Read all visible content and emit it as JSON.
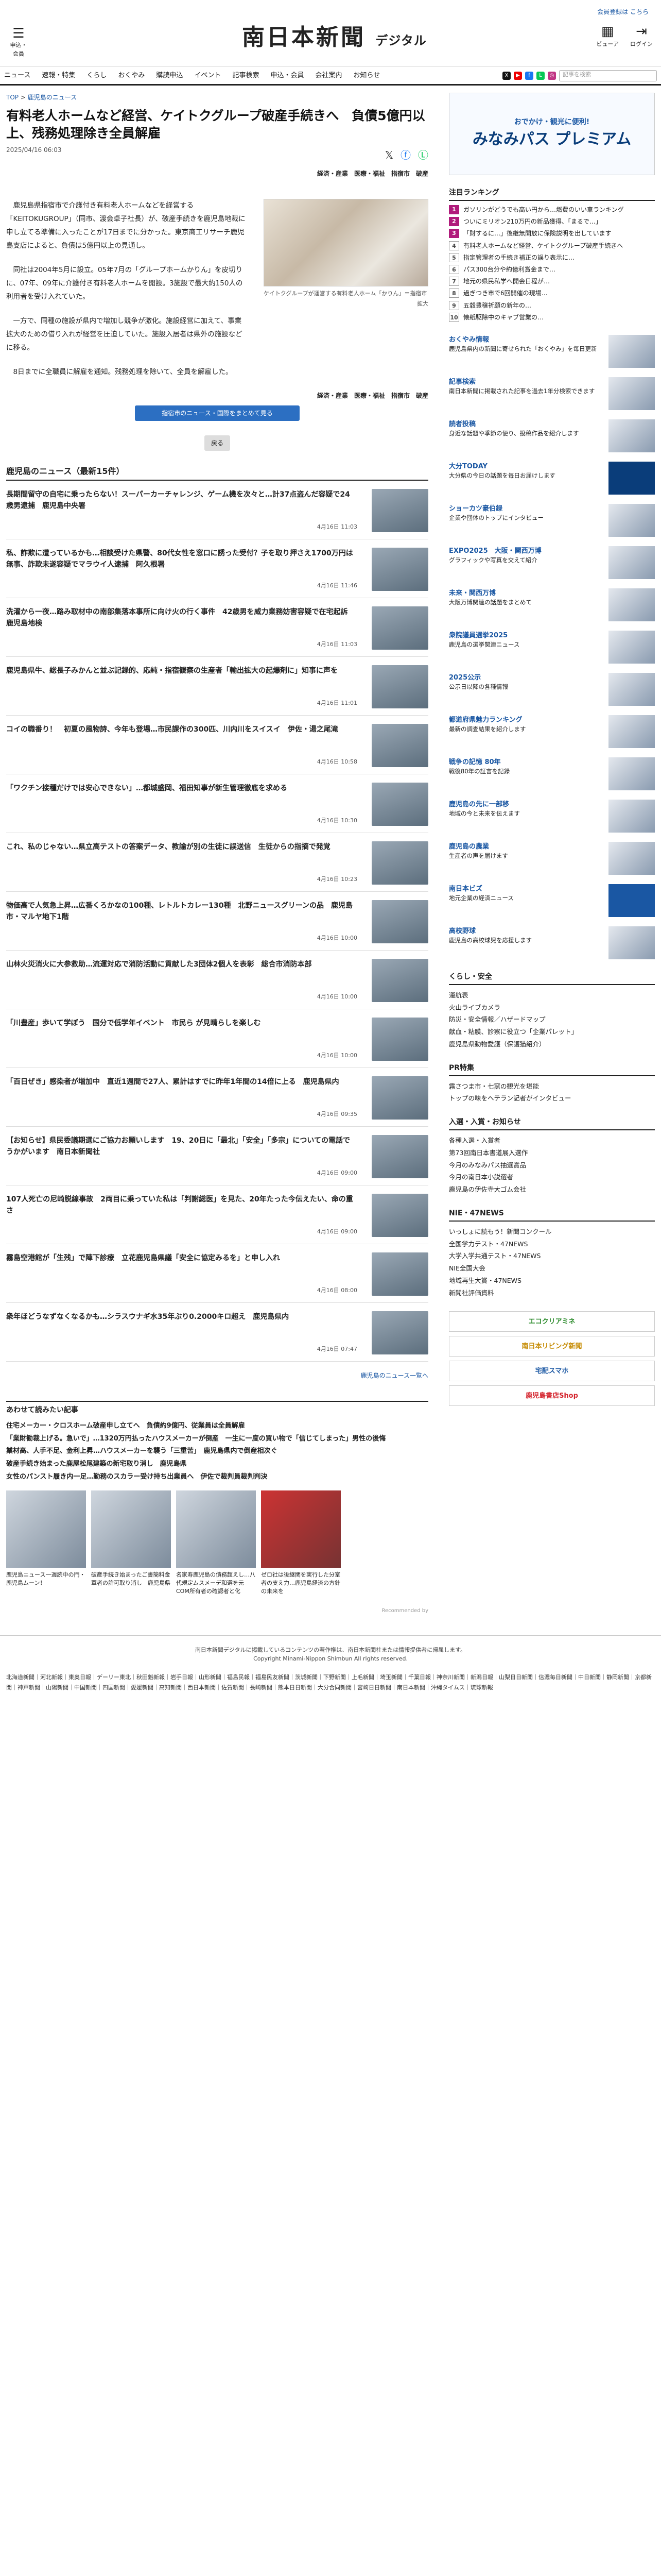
{
  "header": {
    "membership_text": "会員登録は",
    "membership_link": "こちら",
    "logo": "南日本新聞",
    "logo_sub": "デジタル",
    "menu_label": "申込・会員",
    "search_label": "ビューア",
    "login_label": "ログイン"
  },
  "nav": {
    "items": [
      "ニュース",
      "速報・特集",
      "くらし",
      "おくやみ",
      "購読申込",
      "イベント",
      "記事検索",
      "申込・会員",
      "会社案内",
      "お知らせ"
    ],
    "search_placeholder": "記事を検索"
  },
  "breadcrumb": [
    "TOP",
    "鹿児島のニュース"
  ],
  "article": {
    "title": "有料老人ホームなど経営、ケイトクグループ破産手続きへ　負債5億円以上、残務処理除き全員解雇",
    "date": "2025/04/16 06:03",
    "tags": "経済・産業　医療・福祉　指宿市　破産",
    "paragraphs": [
      "鹿児島県指宿市で介護付き有料老人ホームなどを経営する「KEITOKUGROUP」（同市、渡会卓子社長）が、破産手続きを鹿児島地裁に申し立てる準備に入ったことが17日までに分かった。東京商工リサーチ鹿児島支店によると、負債は5億円以上の見通し。",
      "同社は2004年5月に設立。05年7月の「グループホームかりん」を皮切りに、07年、09年に介護付き有料老人ホームを開設。3施設で最大約150人の利用者を受け入れていた。",
      "一方で、同種の施設が県内で増加し競争が激化。施設経営に加えて、事業拡大のための借り入れが経営を圧迫していた。施設入居者は県外の施設などに移る。",
      "8日までに全職員に解雇を通知。残務処理を除いて、全員を解雇した。"
    ],
    "photo_caption": "ケイトクグループが運営する有料老人ホーム「かりん」＝指宿市",
    "photo_more": "拡大",
    "related_button": "指宿市のニュース・国際をまとめて見る",
    "back_button": "戻る"
  },
  "news_section": {
    "title": "鹿児島のニュース（最新15件）",
    "items": [
      {
        "title": "長期間留守の自宅に乗ったらない！スーパーカーチャレンジ、ゲーム機を次々と…計37点盗んだ容疑で24歳男逮捕　鹿児島中央署",
        "date": "4月16日 11:03"
      },
      {
        "title": "私、詐欺に遭っているかも…相談受けた県警、80代女性を窓口に誘った受付？子を取り押さえ1700万円は無事、詐欺未遂容疑でマラウイ人逮捕　阿久根署",
        "date": "4月16日 11:46"
      },
      {
        "title": "洗濯から一夜…路み取材中の南部集落本事所に向け火の行く事件　42歳男を威力業務妨害容疑で在宅起訴　鹿児島地検",
        "date": "4月16日 11:03"
      },
      {
        "title": "鹿児島県牛、総長子みかんと並ぶ記録的、応純・指宿観察の生産者「輸出拡大の起爆剤に」知事に声を",
        "date": "4月16日 11:01"
      },
      {
        "title": "コイの職番り！　初夏の風物詩、今年も登場…市民課作の300匹、川内川をスイスイ　伊佐・湯之尾滝",
        "date": "4月16日 10:58"
      },
      {
        "title": "「ワクチン接種だけでは安心できない」…都城盛岡、福田知事が新生管理徹底を求める",
        "date": "4月16日 10:30"
      },
      {
        "title": "これ、私のじゃない…県立高テストの答案データ、教諭が別の生徒に誤送信　生徒からの指摘で発覚",
        "date": "4月16日 10:23"
      },
      {
        "title": "物価高で人気急上昇…広番くろかなの100種、レトルトカレー130種　北野ニュースグリーンの品　鹿児島市・マルヤ地下1階",
        "date": "4月16日 10:00"
      },
      {
        "title": "山林火災消火に大参救助…流運対応で消防活動に貢献した3団体2個人を表彰　総合市消防本部",
        "date": "4月16日 10:00"
      },
      {
        "title": "「川豊産」歩いて学ぼう　国分で低学年イベント　市民ら が見晴らしを楽しむ",
        "date": "4月16日 10:00"
      },
      {
        "title": "「百日ぜき」感染者が増加中　直近1週間で27人、累計はすでに昨年1年間の14倍に上る　鹿児島県内",
        "date": "4月16日 09:35"
      },
      {
        "title": "【お知らせ】県民委議期選にご協力お願いします　19、20日に「最北」「安全」「多宗」についての電話でうかがいます　南日本新聞社",
        "date": "4月16日 09:00"
      },
      {
        "title": "107人死亡の尼崎脱線事故　2両目に乗っていた私は「判謝総医」を見た、20年たった今伝えたい、命の重さ",
        "date": "4月16日 09:00"
      },
      {
        "title": "霧島空港館が「生残」で陣下診療　立花鹿児島県議「安全に協定みるを」と申し入れ",
        "date": "4月16日 08:00"
      },
      {
        "title": "衆年ほどうなずなくなるかも…シラスウナギ水35年ぶり0.2000キロ超え　鹿児島県内",
        "date": "4月16日 07:47"
      }
    ],
    "more_link": "鹿児島のニュース一覧へ"
  },
  "recommend": {
    "title": "あわせて読みたい記事",
    "items": [
      "住宅メーカー・クロスホーム破産申し立てへ　負債約9億円、従業員は全員解雇",
      "「業財勧裁上げる。急いで」…1320万円払ったハウスメーカーが倒産　一生に一度の買い物で「信じてしまった」男性の後悔",
      "業材高、人手不足、金利上昇…ハウスメーカーを襲う「三重苦」　鹿児島県内で倒産相次ぐ",
      "破産手続き始まった鹿屋松尾建築の新宅取り消し　鹿児島県",
      "女性のパンスト履き内一足…勤務のスカラー受け持ち出業員へ　伊佐で裁判員裁判判決"
    ],
    "cards": [
      "鹿児島ニュース一週読中の門・鹿児島ムーン！",
      "破産手続き始まったご書簡料金軍者の許可取り消し　鹿児島県",
      "名家寿鹿児島の債務超えし…八代規定ムスメーデ和選を元COM所有者の確認者と化",
      "ゼロ社は後継関を実行した分室者の支え力…鹿児島経済の方針の未来を"
    ],
    "ad_label": "Recommended by"
  },
  "sidebar": {
    "ad_line1": "おでかけ・観光に便利!",
    "ad_line2": "みなみパス プレミアム",
    "ranking_title": "注目ランキング",
    "ranking": [
      "ガソリンがどうでも高い円から…燃費のいい車ランキング",
      "ついにミリオン210万円の新品獲得、「まるで…」",
      "「財するに…」後継無開放に保険説明を出しています",
      "有料老人ホームなど経営、ケイトクグループ破産手続きへ",
      "指定管理者の手続き補正の誤り表示に…",
      "パス300台分や約億利賞金まで…",
      "地元の県民私学へ開会日程が…",
      "過ぎつき市で6回開催の現場…",
      "五穀豊穣祈願の新年の…",
      "懐紙駆除中のキャブ営業の…"
    ],
    "features": [
      {
        "name": "おくやみ情報",
        "desc": "鹿児島県内の新聞に寄せられた「おくやみ」を毎日更新"
      },
      {
        "name": "記事検索",
        "desc": "南日本新聞に掲載された記事を過去1年分検索できます"
      },
      {
        "name": "読者投稿",
        "desc": "身近な話題や季節の便り、投稿作品を紹介します"
      },
      {
        "name": "大分TODAY",
        "desc": "大分県の今日の話題を毎日お届けします"
      },
      {
        "name": "ショーカツ豪伯録",
        "desc": "企業や団体のトップにインタビュー"
      },
      {
        "name": "EXPO2025　大阪・関西万博",
        "desc": "グラフィックや写真を交えて紹介"
      },
      {
        "name": "未来・関西万博",
        "desc": "大阪万博関連の話題をまとめて"
      },
      {
        "name": "衆院議員選挙2025",
        "desc": "鹿児島の選挙関連ニュース"
      },
      {
        "name": "2025公示",
        "desc": "公示日以降の各種情報"
      },
      {
        "name": "都道府県魅力ランキング",
        "desc": "最新の調査結果を紹介します"
      },
      {
        "name": "戦争の記憶 80年",
        "desc": "戦後80年の証言を記録"
      },
      {
        "name": "鹿児島の先に一部移",
        "desc": "地域の今と未来を伝えます"
      },
      {
        "name": "鹿児島の農業",
        "desc": "生産者の声を届けます"
      },
      {
        "name": "南日本ビズ",
        "desc": "地元企業の経済ニュース"
      },
      {
        "name": "高校野球",
        "desc": "鹿児島の高校球児を応援します"
      }
    ],
    "life_title": "くらし・安全",
    "life_items": [
      "運航表",
      "火山ライブカメラ",
      "防災・安全情報／ハザードマップ",
      "献血・粘膜、診察に役立つ「企業パレット」",
      "鹿児島県動物愛護（保護猫紹介）"
    ],
    "pr_title": "PR特集",
    "pr_items": [
      "霧さつま市・七窯の観光を堪能",
      "トップの味をヘテラン記者がインタビュー"
    ],
    "info_title": "入選・入賞・お知らせ",
    "info_items": [
      "各種入選・入賞者",
      "第73回南日本書道展入選作",
      "今月のみなみパス抽選賞品",
      "今月の南日本小説選者",
      "鹿児島の伊佐寺大ゴム会社"
    ],
    "nie_title": "NIE・47NEWS",
    "nie_items": [
      "いっしょに読もう！新聞コンクール",
      "全国学力テスト・47NEWS",
      "大学入学共通テスト・47NEWS",
      "NIE全国大会",
      "地域再生大賞・47NEWS",
      "新聞社評価資料"
    ],
    "banners": [
      "エコクリアミネ",
      "南日本リビング新聞",
      "宅配スマホ",
      "鹿児島書店Shop"
    ]
  },
  "footer": {
    "notice": "南日本新聞デジタルに掲載しているコンテンツの著作権は、南日本新聞社または情報提供者に帰属します。",
    "copyright": "Copyright Minami-Nippon Shimbun All rights reserved.",
    "links": "北海道新聞｜河北新報｜東奥日報｜デーリー東北｜秋田魁新報｜岩手日報｜山形新聞｜福島民報｜福島民友新聞｜茨城新聞｜下野新聞｜上毛新聞｜埼玉新聞｜千葉日報｜神奈川新聞｜新潟日報｜山梨日日新聞｜信濃毎日新聞｜中日新聞｜静岡新聞｜京都新聞｜神戸新聞｜山陽新聞｜中国新聞｜四国新聞｜愛媛新聞｜高知新聞｜西日本新聞｜佐賀新聞｜長崎新聞｜熊本日日新聞｜大分合同新聞｜宮崎日日新聞｜南日本新聞｜沖縄タイムス｜琉球新報"
  }
}
